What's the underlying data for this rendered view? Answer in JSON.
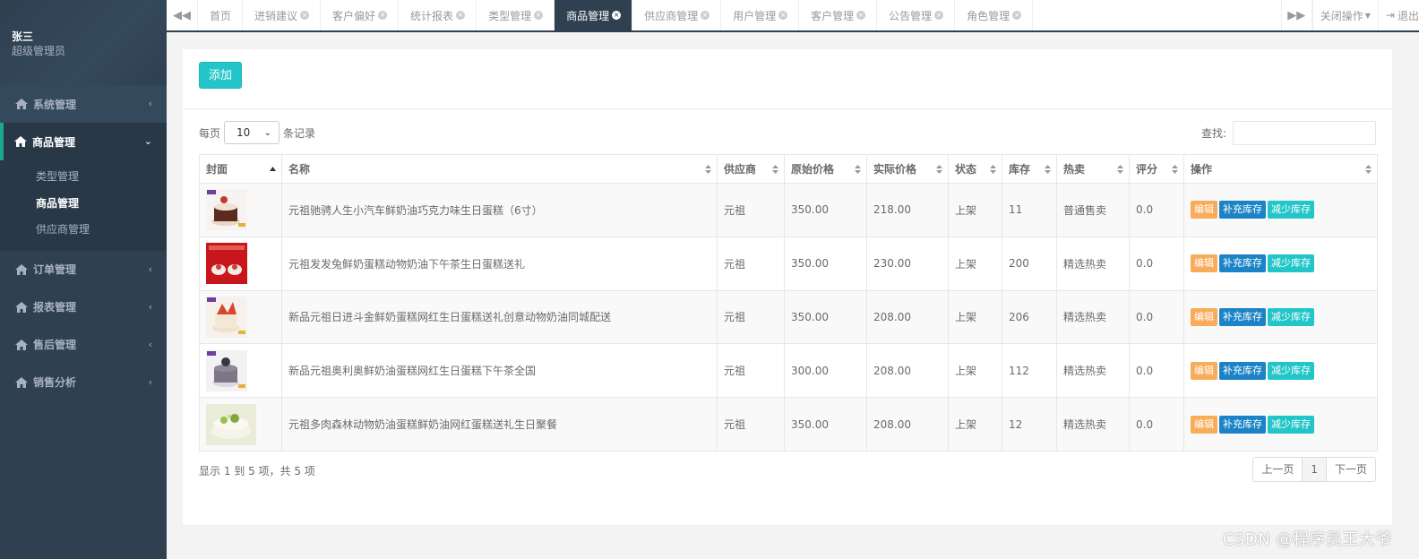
{
  "user": {
    "name": "张三",
    "role": "超级管理员"
  },
  "sidebar": {
    "items": [
      {
        "label": "系统管理",
        "icon": "home-icon"
      },
      {
        "label": "商品管理",
        "icon": "home-icon",
        "children": [
          "类型管理",
          "商品管理",
          "供应商管理"
        ]
      },
      {
        "label": "订单管理",
        "icon": "home-icon"
      },
      {
        "label": "报表管理",
        "icon": "home-icon"
      },
      {
        "label": "售后管理",
        "icon": "home-icon"
      },
      {
        "label": "销售分析",
        "icon": "home-icon"
      }
    ]
  },
  "tabs": [
    {
      "label": "首页"
    },
    {
      "label": "进销建议"
    },
    {
      "label": "客户偏好"
    },
    {
      "label": "统计报表"
    },
    {
      "label": "类型管理"
    },
    {
      "label": "商品管理"
    },
    {
      "label": "供应商管理"
    },
    {
      "label": "用户管理"
    },
    {
      "label": "客户管理"
    },
    {
      "label": "公告管理"
    },
    {
      "label": "角色管理"
    }
  ],
  "tabbar": {
    "close_ops": "关闭操作",
    "logout": "退出"
  },
  "toolbar": {
    "add_label": "添加"
  },
  "table_controls": {
    "per_page_prefix": "每页",
    "per_page_value": "10",
    "per_page_suffix": "条记录",
    "search_label": "查找:"
  },
  "table": {
    "headers": [
      "封面",
      "名称",
      "供应商",
      "原始价格",
      "实际价格",
      "状态",
      "库存",
      "热卖",
      "评分",
      "操作"
    ],
    "rows": [
      {
        "name": "元祖驰骋人生小汽车鲜奶油巧克力味生日蛋糕（6寸）",
        "supplier": "元祖",
        "original_price": "350.00",
        "actual_price": "218.00",
        "status": "上架",
        "stock": "11",
        "hot": "普通售卖",
        "rating": "0.0"
      },
      {
        "name": "元祖发发兔鲜奶蛋糕动物奶油下午茶生日蛋糕送礼",
        "supplier": "元祖",
        "original_price": "350.00",
        "actual_price": "230.00",
        "status": "上架",
        "stock": "200",
        "hot": "精选热卖",
        "rating": "0.0"
      },
      {
        "name": "新品元祖日进斗金鲜奶蛋糕网红生日蛋糕送礼创意动物奶油同城配送",
        "supplier": "元祖",
        "original_price": "350.00",
        "actual_price": "208.00",
        "status": "上架",
        "stock": "206",
        "hot": "精选热卖",
        "rating": "0.0"
      },
      {
        "name": "新品元祖奥利奥鲜奶油蛋糕网红生日蛋糕下午茶全国",
        "supplier": "元祖",
        "original_price": "300.00",
        "actual_price": "208.00",
        "status": "上架",
        "stock": "112",
        "hot": "精选热卖",
        "rating": "0.0"
      },
      {
        "name": "元祖多肉森林动物奶油蛋糕鲜奶油网红蛋糕送礼生日聚餐",
        "supplier": "元祖",
        "original_price": "350.00",
        "actual_price": "208.00",
        "status": "上架",
        "stock": "12",
        "hot": "精选热卖",
        "rating": "0.0"
      }
    ],
    "actions": {
      "edit": "编辑",
      "add_stock": "补充库存",
      "reduce_stock": "减少库存"
    }
  },
  "pagination": {
    "info": "显示 1 到 5 项，共 5 项",
    "prev": "上一页",
    "page": "1",
    "next": "下一页"
  },
  "watermark": "CSDN @程序员王大爷",
  "colors": {
    "sidebar": "#2f4050",
    "accent": "#23c6c8",
    "edit": "#f8ac59",
    "primary": "#1c84c6"
  }
}
